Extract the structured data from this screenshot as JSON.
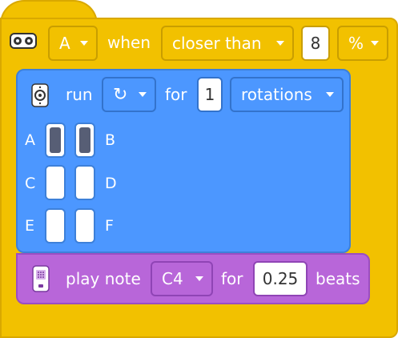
{
  "event": {
    "port": "A",
    "when_label": "when",
    "condition": "closer than",
    "value": "8",
    "unit": "%",
    "icon": "distance-sensor-icon"
  },
  "motor": {
    "run_label": "run",
    "direction": "↻",
    "for_label": "for",
    "amount": "1",
    "unit": "rotations",
    "icon": "motor-icon",
    "ports": [
      {
        "label": "A",
        "selected": true
      },
      {
        "label": "B",
        "selected": true
      },
      {
        "label": "C",
        "selected": false
      },
      {
        "label": "D",
        "selected": false
      },
      {
        "label": "E",
        "selected": false
      },
      {
        "label": "F",
        "selected": false
      }
    ]
  },
  "sound": {
    "play_label": "play note",
    "note": "C4",
    "for_label": "for",
    "duration": "0.25",
    "beats_label": "beats",
    "icon": "hub-speaker-icon"
  },
  "colors": {
    "event": "#f2c100",
    "motor": "#4c97ff",
    "sound": "#b866d9"
  }
}
